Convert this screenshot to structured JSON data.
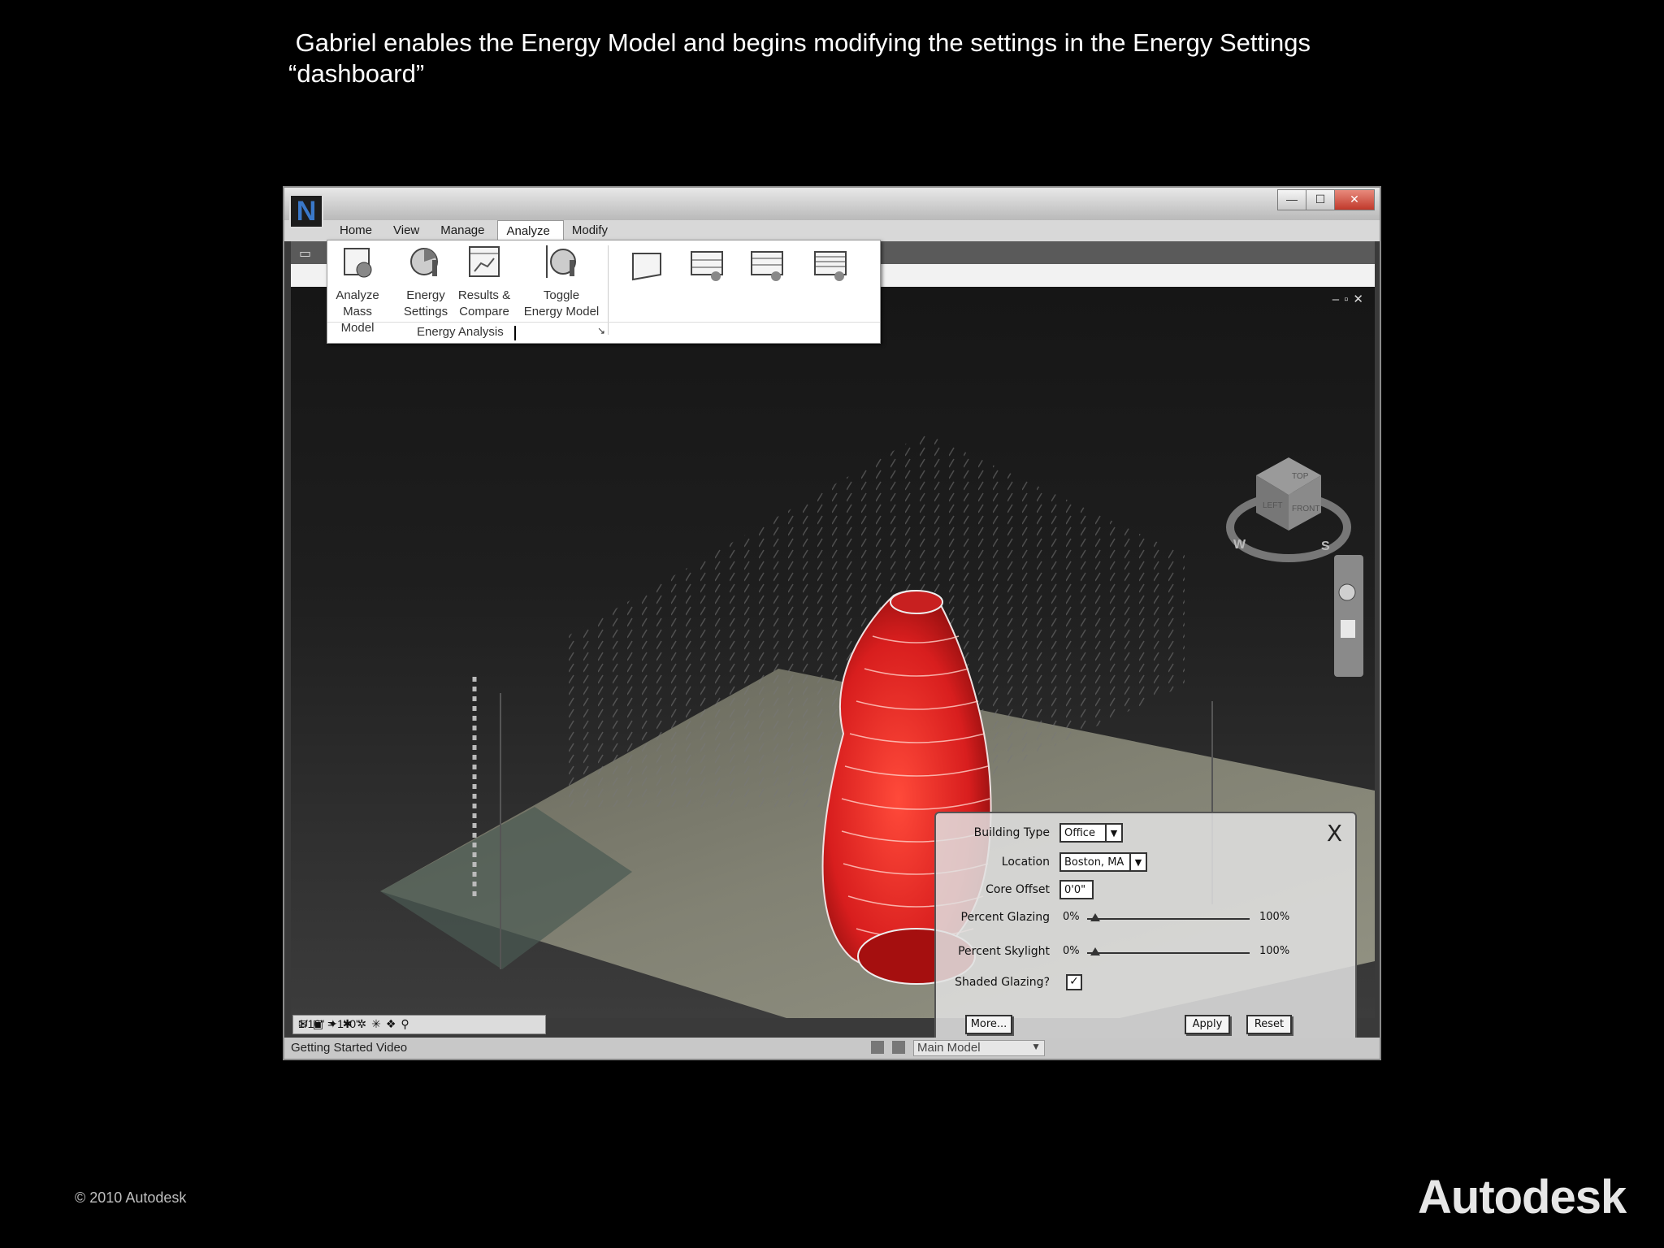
{
  "caption": {
    "line1": " Gabriel enables the Energy Model and begins modifying the settings in the Energy Settings",
    "line2": "“dashboard”"
  },
  "footer": {
    "copyright": "© 2010 Autodesk",
    "brand": "Autodesk"
  },
  "app": {
    "logo_letter": "N",
    "window_buttons": {
      "minimize": "—",
      "maximize": "☐",
      "close": "✕"
    },
    "menu": [
      "Home",
      "View",
      "Manage",
      "Analyze",
      "Modify"
    ],
    "active_menu": "Analyze"
  },
  "ribbon": {
    "buttons": [
      {
        "line1": "Analyze",
        "line2": "Mass Model",
        "icon": "analyze-mass-model-icon"
      },
      {
        "line1": "Energy",
        "line2": "Settings",
        "icon": "energy-settings-icon"
      },
      {
        "line1": "Results &",
        "line2": "Compare",
        "icon": "results-compare-icon"
      },
      {
        "line1": "Toggle",
        "line2": "Energy Model",
        "icon": "toggle-energy-model-icon"
      }
    ],
    "panel_label": "Energy Analysis",
    "launcher": "↘"
  },
  "viewcube": {
    "top": "TOP",
    "left": "LEFT",
    "front": "FRONT",
    "west": "W",
    "south": "S"
  },
  "energy_dialog": {
    "building_type_label": "Building Type",
    "building_type_value": "Office",
    "location_label": "Location",
    "location_value": "Boston, MA",
    "core_offset_label": "Core Offset",
    "core_offset_value": "0'0\"",
    "percent_glazing_label": "Percent Glazing",
    "percent_skylight_label": "Percent Skylight",
    "slider_min": "0%",
    "slider_max": "100%",
    "glazing_level": 0.05,
    "skylight_level": 0.05,
    "shaded_glazing_label": "Shaded Glazing?",
    "shaded_glazing_checked": true,
    "close_label": "X",
    "more_label": "More...",
    "apply_label": "Apply",
    "reset_label": "Reset"
  },
  "statusbar": {
    "scale": "1/16\" = 1'-0\"",
    "text": "Getting Started Video",
    "model_select": "Main Model"
  }
}
